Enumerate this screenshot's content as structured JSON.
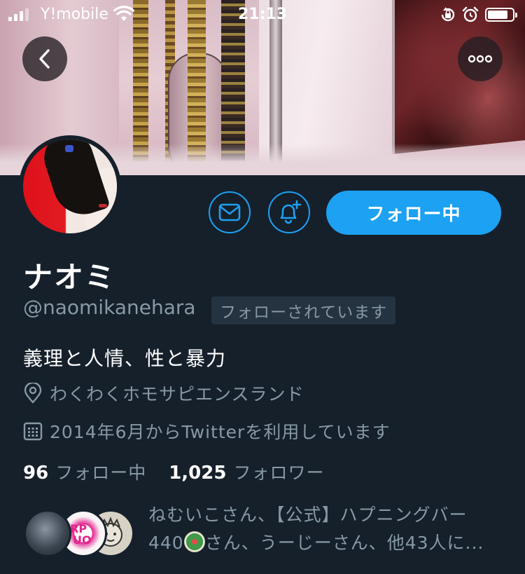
{
  "status_bar": {
    "carrier": "Y!mobile",
    "time": "21:13"
  },
  "icons": {
    "back": "chevron-left-icon",
    "more": "ellipsis-icon",
    "dm": "envelope-icon",
    "notify": "bell-plus-icon",
    "location": "location-pin-icon",
    "calendar": "calendar-icon"
  },
  "profile": {
    "name": "ナオミ",
    "handle": "@naomikanehara",
    "follows_you": "フォローされています",
    "bio": "義理と人情、性と暴力",
    "location": "わくわくホモサピエンスランド",
    "joined": "2014年6月からTwitterを利用しています"
  },
  "actions": {
    "follow_label": "フォロー中"
  },
  "counts": {
    "following_num": "96",
    "following_label": "フォロー中",
    "followers_num": "1,025",
    "followers_label": "フォロワー"
  },
  "followed_by": {
    "line1": "ねむいこさん、【公式】ハプニングバー",
    "line2_a": "440",
    "line2_b": "さん、うーじーさん、他43人に..."
  },
  "colors": {
    "background": "#15202b",
    "accent": "#1da1f2",
    "secondary_text": "#8899a6"
  }
}
